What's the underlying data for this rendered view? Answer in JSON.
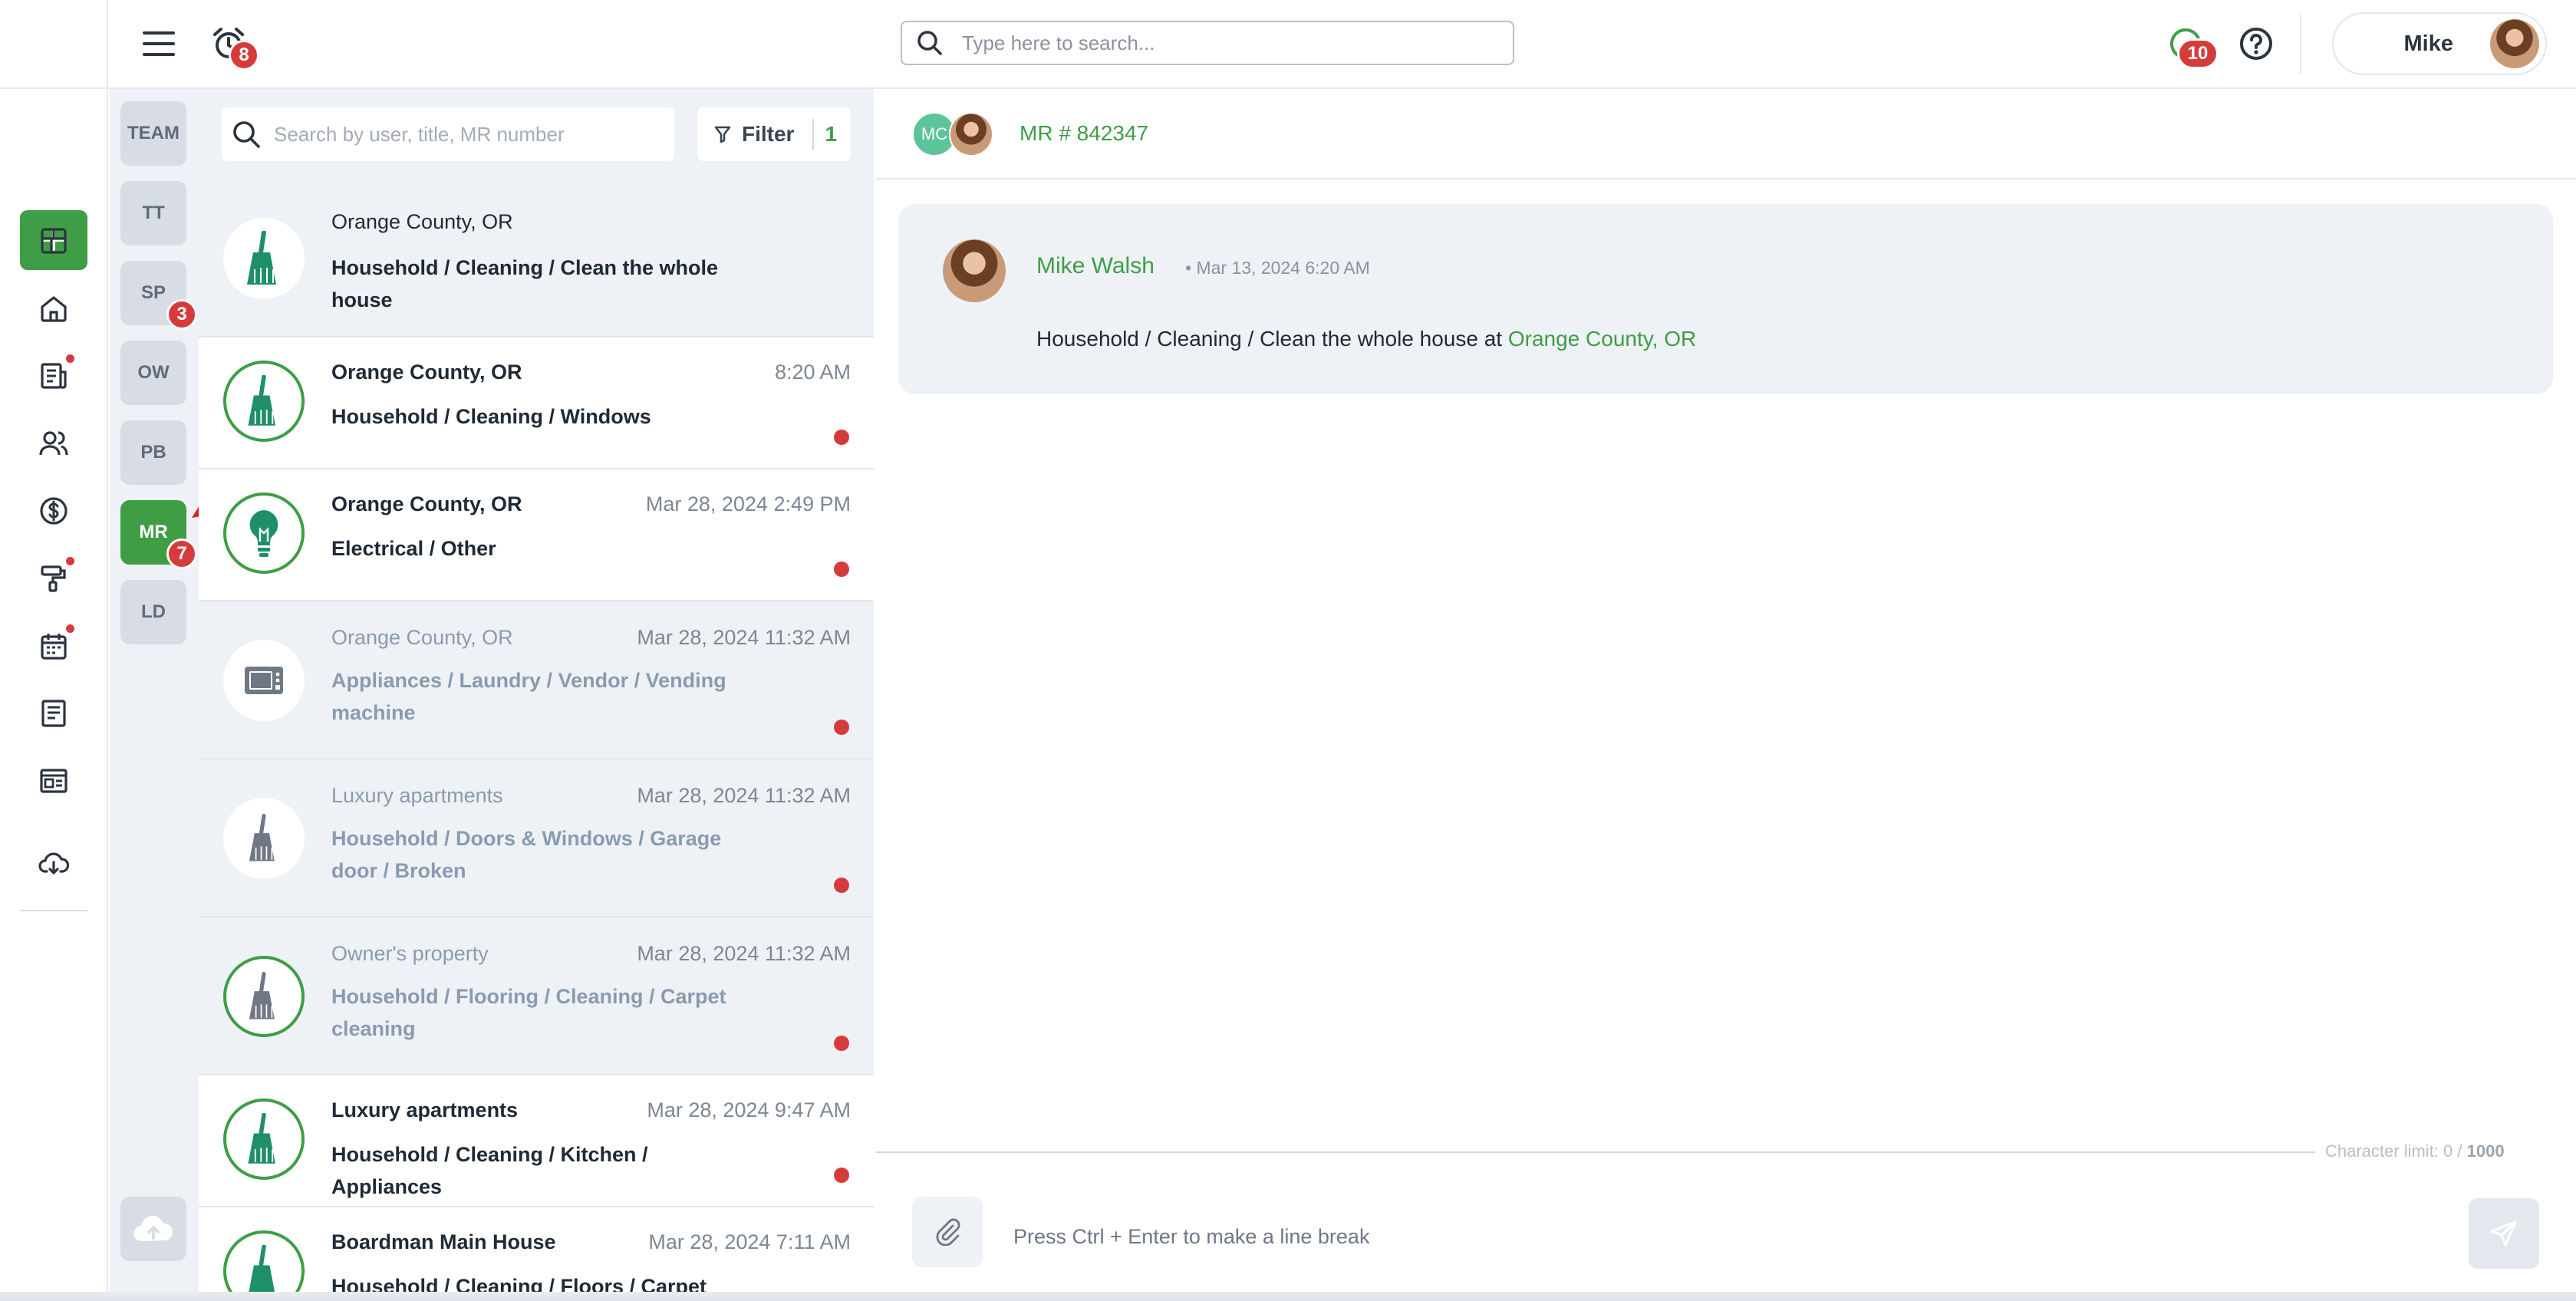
{
  "header": {
    "alarm_badge": "8",
    "search_placeholder": "Type here to search...",
    "chat_badge": "10",
    "user_name": "Mike"
  },
  "rail": {
    "items": [
      "dashboard-icon",
      "home-icon",
      "document-icon",
      "users-icon",
      "dollar-icon",
      "paint-roller-icon",
      "calendar-icon",
      "notes-icon",
      "id-card-icon",
      "cloud-download-icon"
    ]
  },
  "categories": [
    {
      "label": "TEAM",
      "badge": ""
    },
    {
      "label": "TT",
      "badge": ""
    },
    {
      "label": "SP",
      "badge": "3"
    },
    {
      "label": "OW",
      "badge": ""
    },
    {
      "label": "PB",
      "badge": ""
    },
    {
      "label": "MR",
      "badge": "7",
      "active": true
    },
    {
      "label": "LD",
      "badge": ""
    }
  ],
  "list": {
    "search_placeholder": "Search by user, title, MR number",
    "filter_label": "Filter",
    "filter_count": "1",
    "items": [
      {
        "location": "Orange County, OR",
        "time": "",
        "title": "Household / Cleaning / Clean the whole house",
        "icon": "broom-icon",
        "state": "selected"
      },
      {
        "location": "Orange County, OR",
        "time": "8:20 AM",
        "title": "Household / Cleaning / Windows",
        "icon": "broom-icon",
        "state": "unread"
      },
      {
        "location": "Orange County, OR",
        "time": "Mar 28, 2024 2:49 PM",
        "title": "Electrical / Other",
        "icon": "lightbulb-icon",
        "state": "unread"
      },
      {
        "location": "Orange County, OR",
        "time": "Mar 28, 2024 11:32 AM",
        "title": "Appliances / Laundry / Vendor / Vending machine",
        "icon": "microwave-icon",
        "state": "dim"
      },
      {
        "location": "Luxury apartments",
        "time": "Mar 28, 2024 11:32 AM",
        "title": "Household / Doors & Windows / Garage door / Broken",
        "icon": "broom-icon",
        "state": "dim"
      },
      {
        "location": "Owner's property",
        "time": "Mar 28, 2024 11:32 AM",
        "title": "Household / Flooring / Cleaning / Carpet cleaning",
        "icon": "broom-icon",
        "state": "dim"
      },
      {
        "location": "Luxury apartments",
        "time": "Mar 28, 2024 9:47 AM",
        "title": "Household / Cleaning / Kitchen / Appliances",
        "icon": "broom-icon",
        "state": "unread"
      },
      {
        "location": "Boardman Main House",
        "time": "Mar 28, 2024 7:11 AM",
        "title": "Household / Cleaning / Floors / Carpet",
        "icon": "broom-icon",
        "state": "normal"
      }
    ]
  },
  "chat": {
    "initials": "MC",
    "mr_number": "MR # 842347",
    "message": {
      "author": "Mike Walsh",
      "date": "Mar 13, 2024 6:20 AM",
      "text": "Household / Cleaning / Clean the whole house",
      "at": "at",
      "location": "Orange County, OR"
    },
    "char_limit_label": "Character limit: 0 /",
    "char_limit_max": "1000",
    "compose_placeholder": "Press Ctrl + Enter to make a line break"
  },
  "colors": {
    "accent": "#3f9e45",
    "badge": "#d63b3b",
    "panel": "#eef1f5"
  }
}
